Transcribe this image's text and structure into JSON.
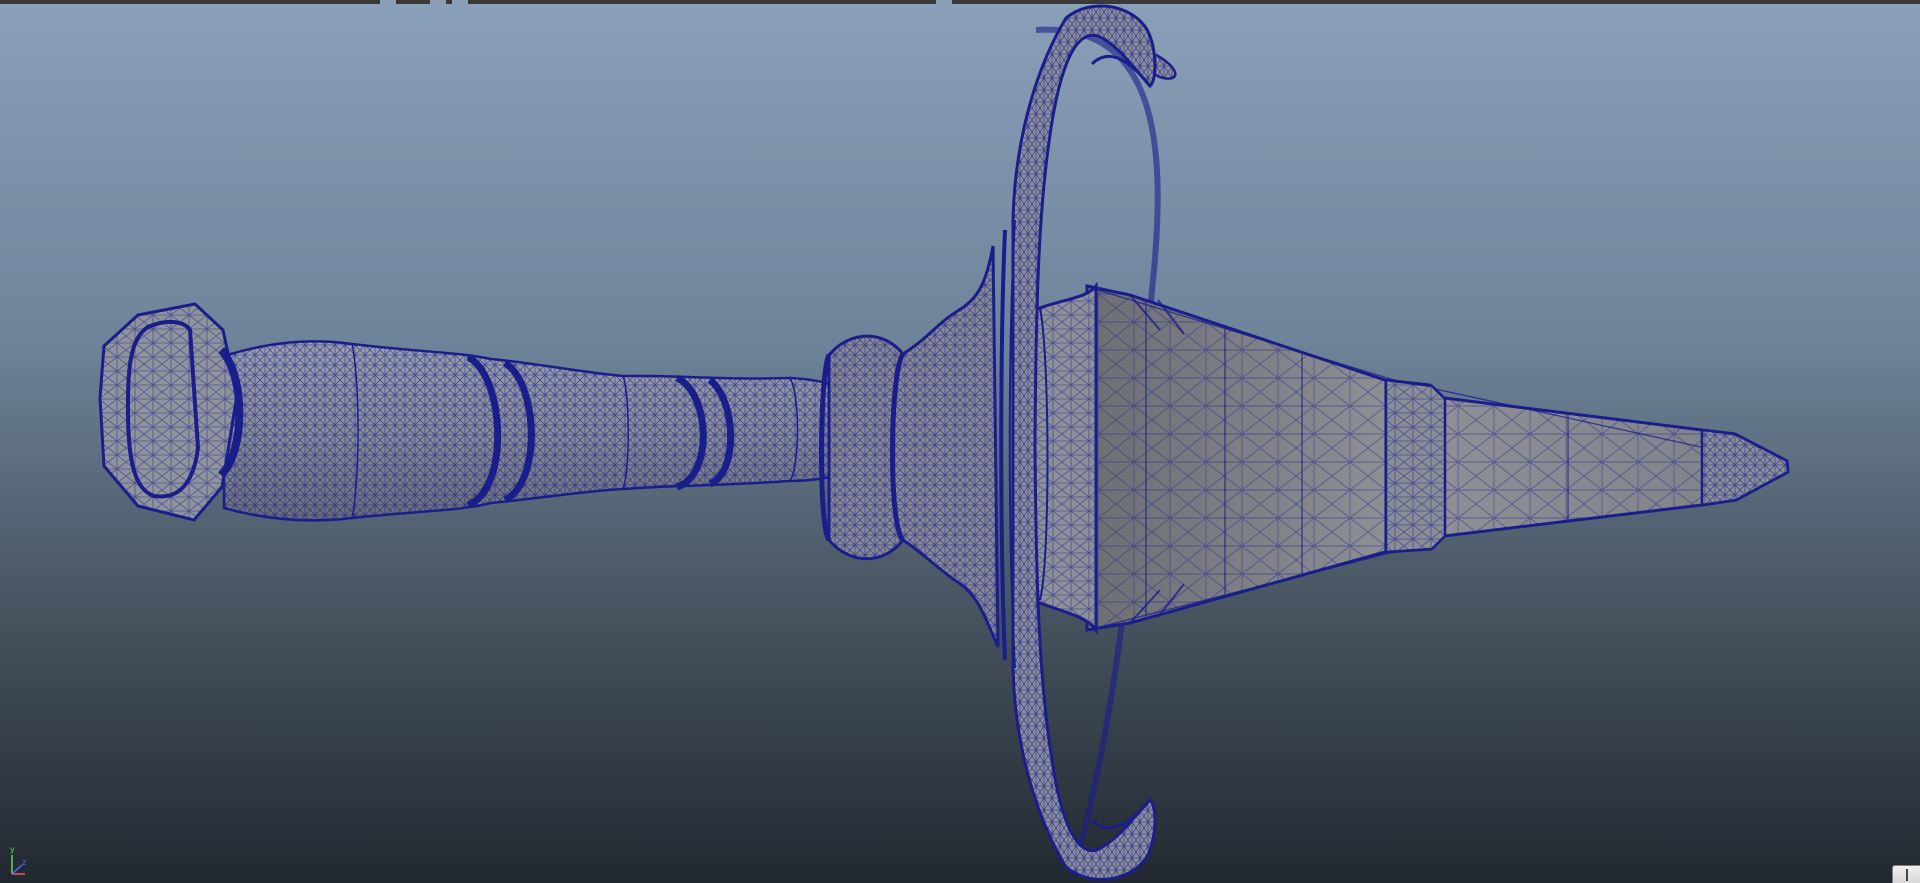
{
  "viewport": {
    "background_top": "#8aa0b8",
    "background_bottom": "#222830"
  },
  "model": {
    "wireframe_color": "#1a1e8a",
    "surface_color": "#8f9197"
  },
  "axis_gizmo": {
    "y_label": "y",
    "x_label": "",
    "z_label": "z"
  }
}
